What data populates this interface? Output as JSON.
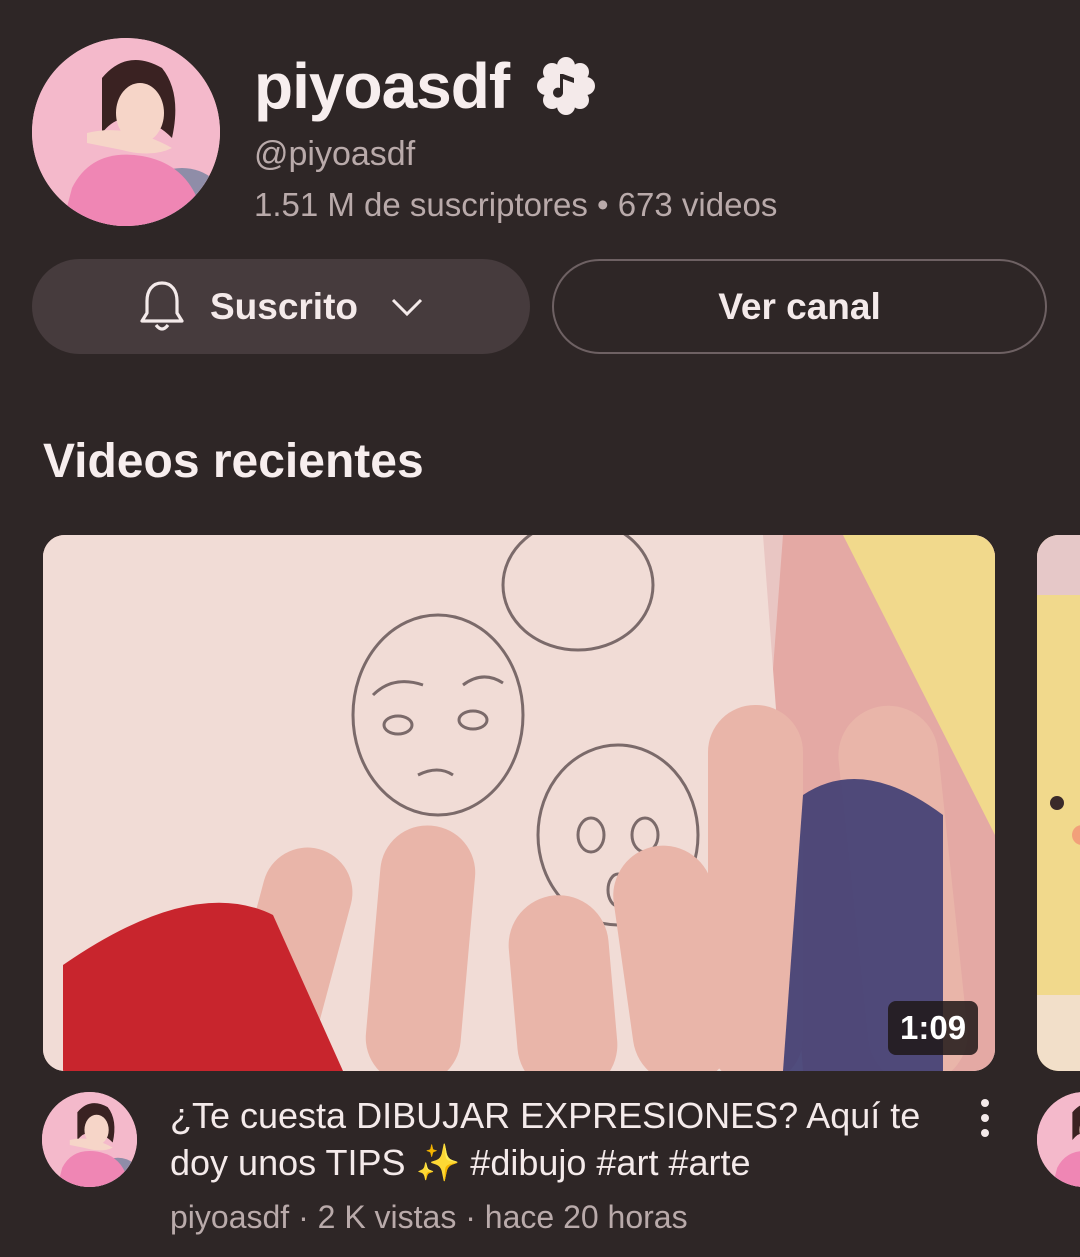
{
  "channel": {
    "name": "piyoasdf",
    "handle": "@piyoasdf",
    "stats": "1.51 M de suscriptores • 673 videos",
    "avatar_icon": "channel-avatar",
    "badge_icon": "music-note-badge-icon"
  },
  "actions": {
    "subscribed_label": "Suscrito",
    "view_channel_label": "Ver canal"
  },
  "section": {
    "title": "Videos recientes"
  },
  "video": {
    "duration": "1:09",
    "title": "¿Te cuesta DIBUJAR EXPRESIONES? Aquí te doy unos TIPS ✨ #dibujo #art #arte",
    "meta": "piyoasdf · 2 K vistas · hace 20 horas"
  },
  "colors": {
    "background": "#2e2626",
    "button_bg": "#463b3d",
    "secondary_text": "#b9aaaa"
  }
}
